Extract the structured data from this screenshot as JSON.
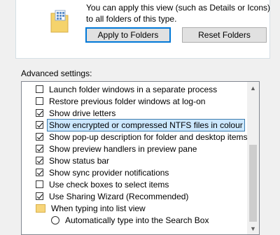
{
  "folder_views": {
    "description": "You can apply this view (such as Details or Icons) to all folders of this type.",
    "apply_button": "Apply to Folders",
    "reset_button": "Reset Folders"
  },
  "advanced": {
    "label": "Advanced settings:",
    "items": [
      {
        "type": "checkbox",
        "checked": false,
        "selected": false,
        "label": "Launch folder windows in a separate process"
      },
      {
        "type": "checkbox",
        "checked": false,
        "selected": false,
        "label": "Restore previous folder windows at log-on"
      },
      {
        "type": "checkbox",
        "checked": true,
        "selected": false,
        "label": "Show drive letters"
      },
      {
        "type": "checkbox",
        "checked": true,
        "selected": true,
        "label": "Show encrypted or compressed NTFS files in colour"
      },
      {
        "type": "checkbox",
        "checked": true,
        "selected": false,
        "label": "Show pop-up description for folder and desktop items"
      },
      {
        "type": "checkbox",
        "checked": true,
        "selected": false,
        "label": "Show preview handlers in preview pane"
      },
      {
        "type": "checkbox",
        "checked": true,
        "selected": false,
        "label": "Show status bar"
      },
      {
        "type": "checkbox",
        "checked": true,
        "selected": false,
        "label": "Show sync provider notifications"
      },
      {
        "type": "checkbox",
        "checked": false,
        "selected": false,
        "label": "Use check boxes to select items"
      },
      {
        "type": "checkbox",
        "checked": true,
        "selected": false,
        "label": "Use Sharing Wizard (Recommended)"
      },
      {
        "type": "folder",
        "label": "When typing into list view"
      },
      {
        "type": "radio",
        "label": "Automatically type into the Search Box"
      }
    ]
  },
  "icons": {
    "folder": "folder-view-icon",
    "scroll_up": "scroll-up-arrow-icon",
    "scroll_down": "scroll-down-arrow-icon"
  }
}
